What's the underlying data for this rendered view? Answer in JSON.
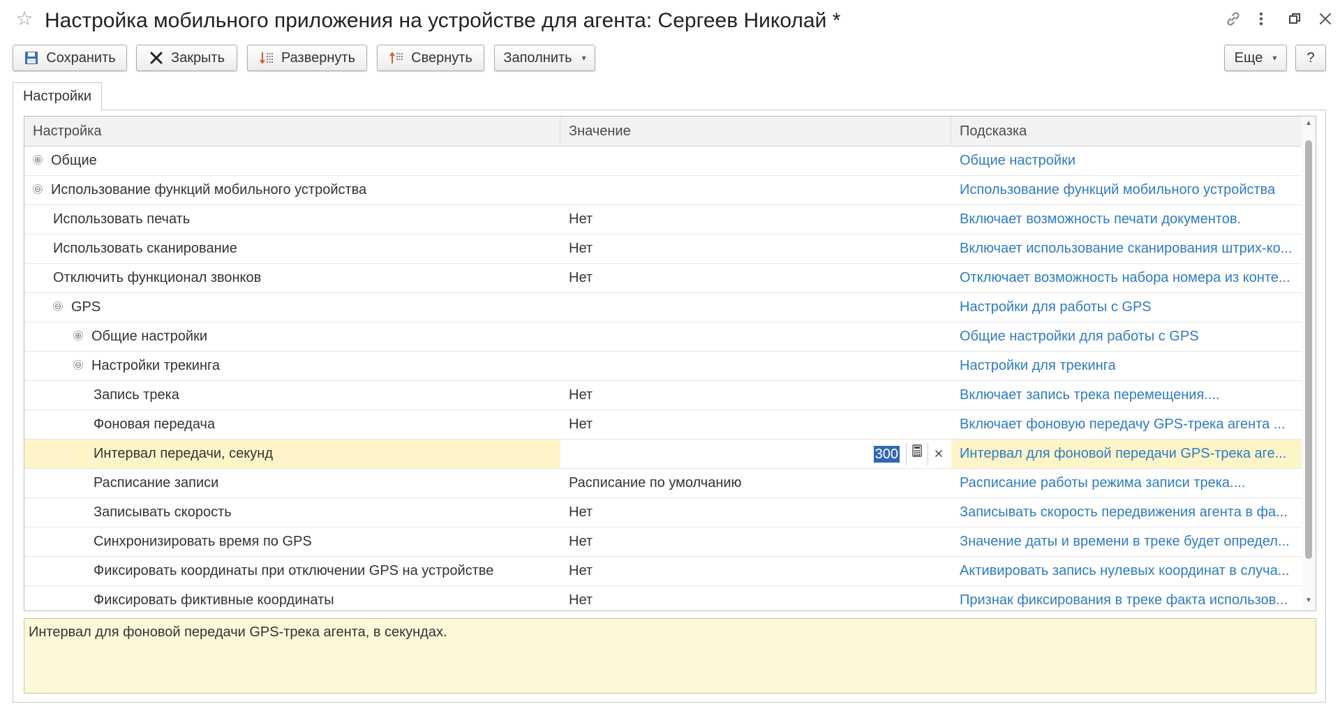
{
  "window": {
    "title": "Настройка мобильного приложения на устройстве для агента: Сергеев Николай *"
  },
  "toolbar": {
    "save_label": "Сохранить",
    "close_label": "Закрыть",
    "expand_label": "Развернуть",
    "collapse_label": "Свернуть",
    "fill_label": "Заполнить",
    "more_label": "Еще",
    "help_label": "?"
  },
  "tabs": [
    {
      "label": "Настройки"
    }
  ],
  "table": {
    "columns": [
      "Настройка",
      "Значение",
      "Подсказка"
    ],
    "rows": [
      {
        "name": "Общие",
        "value": "",
        "hint": "Общие настройки",
        "level": 0,
        "toggle": "⊕"
      },
      {
        "name": "Использование функций мобильного устройства",
        "value": "",
        "hint": "Использование функций мобильного устройства",
        "level": 0,
        "toggle": "⊖"
      },
      {
        "name": "Использовать печать",
        "value": "Нет",
        "hint": "Включает возможность печати документов.",
        "level": 1,
        "toggle": ""
      },
      {
        "name": "Использовать сканирование",
        "value": "Нет",
        "hint": "Включает использование сканирования штрих-ко...",
        "level": 1,
        "toggle": ""
      },
      {
        "name": "Отключить функционал звонков",
        "value": "Нет",
        "hint": "Отключает возможность набора номера из конте...",
        "level": 1,
        "toggle": ""
      },
      {
        "name": "GPS",
        "value": "",
        "hint": "Настройки для работы с GPS",
        "level": 1,
        "toggle": "⊖"
      },
      {
        "name": "Общие настройки",
        "value": "",
        "hint": "Общие настройки для работы с GPS",
        "level": 2,
        "toggle": "⊕"
      },
      {
        "name": "Настройки трекинга",
        "value": "",
        "hint": "Настройки для трекинга",
        "level": 2,
        "toggle": "⊖"
      },
      {
        "name": "Запись трека",
        "value": "Нет",
        "hint": "Включает запись трека перемещения....",
        "level": 3,
        "toggle": ""
      },
      {
        "name": "Фоновая передача",
        "value": "Нет",
        "hint": "Включает фоновую передачу GPS-трека агента ...",
        "level": 3,
        "toggle": ""
      },
      {
        "name": "Интервал передачи, секунд",
        "value": "300",
        "hint": "Интервал для фоновой передачи GPS-трека аге...",
        "level": 3,
        "toggle": "",
        "editing": true
      },
      {
        "name": "Расписание записи",
        "value": "Расписание по умолчанию",
        "hint": "Расписание работы режима записи трека....",
        "level": 3,
        "toggle": ""
      },
      {
        "name": "Записывать скорость",
        "value": "Нет",
        "hint": "Записывать скорость передвижения агента в фа...",
        "level": 3,
        "toggle": ""
      },
      {
        "name": "Синхронизировать время по GPS",
        "value": "Нет",
        "hint": "Значение даты и времени в треке будет определ...",
        "level": 3,
        "toggle": ""
      },
      {
        "name": "Фиксировать координаты при отключении GPS на устройстве",
        "value": "Нет",
        "hint": "Активировать запись нулевых координат в случа...",
        "level": 3,
        "toggle": ""
      },
      {
        "name": "Фиксировать фиктивные координаты",
        "value": "Нет",
        "hint": "Признак фиксирования в треке факта использов...",
        "level": 3,
        "toggle": ""
      }
    ]
  },
  "hint_panel": {
    "text": "Интервал для фоновой передачи GPS-трека агента, в секундах."
  },
  "colors": {
    "hint_link": "#2f7cc4",
    "selected_row": "#fdf5c8",
    "hint_panel_bg": "#fdf9d8"
  },
  "icons": {
    "favorite": "star-icon",
    "link": "link-icon",
    "menu": "more-vertical-icon",
    "restore": "restore-window-icon",
    "close": "close-icon"
  }
}
